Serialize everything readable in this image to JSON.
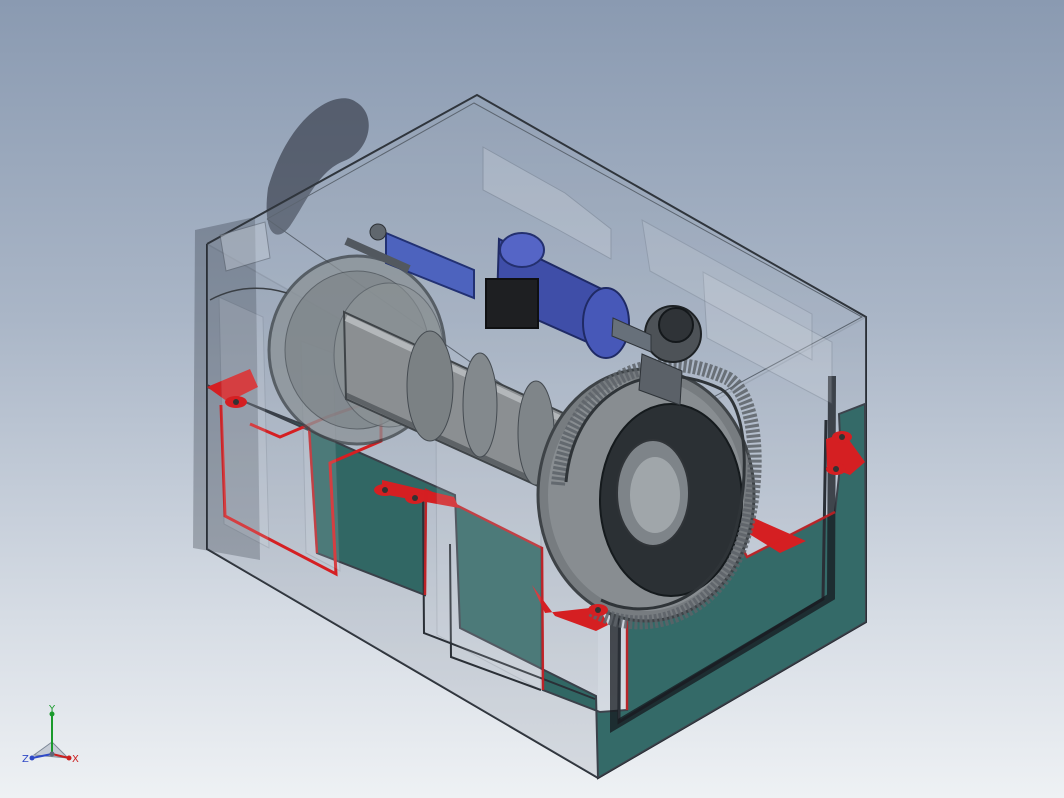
{
  "viewport": {
    "background_top": "#8a9ab1",
    "background_bottom": "#eef1f4"
  },
  "model": {
    "housing_fill": "#1f5f58",
    "housing_edge": "#2a2f36",
    "cut_color": "#d51f22",
    "shadow_color": "#2f3440",
    "motor_color": "#3f4ea8",
    "gear_color": "#8e8e8e"
  },
  "triad": {
    "y_label": "Y",
    "x_label": "X",
    "z_label": "Z",
    "x_color": "#cc1f1f",
    "y_color": "#1a9a2c",
    "z_color": "#2f49c6"
  }
}
